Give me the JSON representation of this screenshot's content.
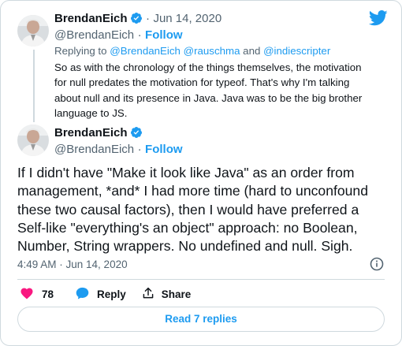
{
  "colors": {
    "accent": "#1d9bf0",
    "muted": "#536471",
    "heart": "#f91880",
    "border": "#cfd9de",
    "text": "#0f1419"
  },
  "reply_tweet": {
    "author_name": "BrendanEich",
    "separator": "·",
    "date": "Jun 14, 2020",
    "handle": "@BrendanEich",
    "follow_sep": "·",
    "follow_label": "Follow",
    "replying_prefix": "Replying to",
    "replying_to": [
      "@BrendanEich",
      "@rauschma",
      "@indiescripter"
    ],
    "replying_and": "and",
    "text_lines": [
      "So as with the chronology of the things themselves, the motivation",
      "for null predates the motivation for typeof. That's why I'm talking",
      "about null and its presence in Java. Java was to be the big brother",
      "language to JS."
    ]
  },
  "main_tweet": {
    "author_name": "BrendanEich",
    "handle": "@BrendanEich",
    "follow_sep": "·",
    "follow_label": "Follow",
    "text_lines": [
      "If I didn't have \"Make it look like Java\" as an order from",
      "management, *and* I had more time (hard to unconfound",
      "these two causal factors), then I would have preferred a",
      "Self-like \"everything's an object\" approach: no Boolean,",
      "Number, String wrappers. No undefined and null. Sigh."
    ],
    "timestamp": "4:49 AM · Jun 14, 2020",
    "like_count": "78",
    "reply_label": "Reply",
    "share_label": "Share"
  },
  "icons": {
    "brand": "twitter-bird-icon",
    "verified": "verified-badge-icon",
    "info": "info-icon",
    "like": "heart-icon",
    "reply": "speech-bubble-icon",
    "share": "share-icon"
  },
  "read_replies_label": "Read 7 replies"
}
